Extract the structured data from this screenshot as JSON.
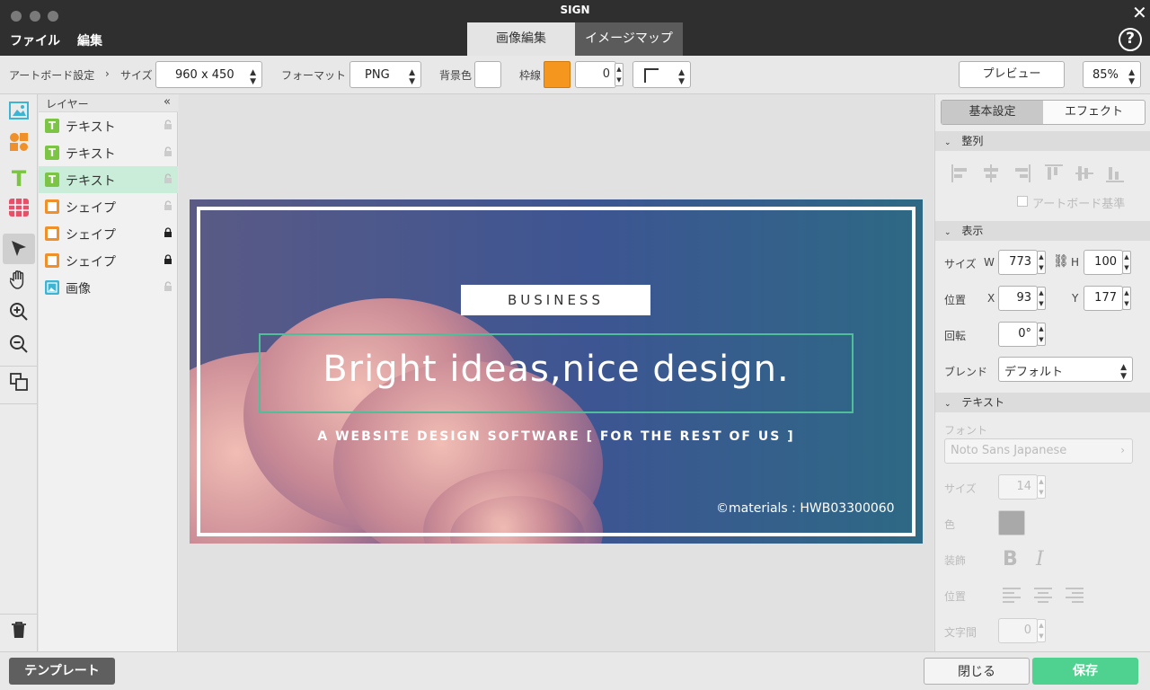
{
  "window": {
    "title": "SIGN",
    "menu": [
      "ファイル",
      "編集"
    ],
    "tabs": [
      "画像編集",
      "イメージマップ"
    ],
    "help": "?",
    "close": "✕"
  },
  "toolbar": {
    "artboard_label": "アートボード設定",
    "chevron": "›",
    "size_label": "サイズ",
    "size_value": "960 x 450",
    "format_label": "フォーマット",
    "format_value": "PNG",
    "bg_label": "背景色",
    "bg_color": "#ffffff",
    "border_label": "枠線",
    "border_color": "#f5961e",
    "border_width": "0",
    "preview": "プレビュー",
    "zoom": "85%"
  },
  "layers": {
    "title": "レイヤー",
    "collapse": "«",
    "items": [
      {
        "name": "テキスト",
        "type": "text",
        "locked": false,
        "selected": false
      },
      {
        "name": "テキスト",
        "type": "text",
        "locked": false,
        "selected": false
      },
      {
        "name": "テキスト",
        "type": "text",
        "locked": false,
        "selected": true
      },
      {
        "name": "シェイプ",
        "type": "shape",
        "locked": false,
        "selected": false
      },
      {
        "name": "シェイプ",
        "type": "shape",
        "locked": true,
        "selected": false
      },
      {
        "name": "シェイプ",
        "type": "shape",
        "locked": true,
        "selected": false
      },
      {
        "name": "画像",
        "type": "image",
        "locked": false,
        "selected": false
      }
    ]
  },
  "tools": [
    "image-tool-icon",
    "shapes-tool-icon",
    "text-tool-icon",
    "table-tool-icon",
    "select-arrow-icon",
    "hand-icon",
    "zoom-in-icon",
    "zoom-out-icon",
    "copy-icon",
    "trash-icon"
  ],
  "artboard": {
    "badge": "BUSINESS",
    "headline": "Bright ideas,nice design.",
    "subline": "A WEBSITE DESIGN SOFTWARE [ FOR THE REST OF US ]",
    "credit": "©materials : HWB03300060"
  },
  "panel": {
    "tabs": [
      "基本設定",
      "エフェクト"
    ],
    "align_title": "整列",
    "artboard_base": "アートボード基準",
    "display_title": "表示",
    "size_label": "サイズ",
    "w_label": "W",
    "w": "773",
    "h_label": "H",
    "h": "100",
    "pos_label": "位置",
    "x_label": "X",
    "x": "93",
    "y_label": "Y",
    "y": "177",
    "rotate_label": "回転",
    "rotate": "0°",
    "blend_label": "ブレンド",
    "blend": "デフォルト",
    "text_title": "テキスト",
    "font_label": "フォント",
    "font": "Noto Sans Japanese",
    "font_size_label": "サイズ",
    "font_size": "14",
    "color_label": "色",
    "color": "#a9a9a9",
    "deco_label": "装飾",
    "bold": "B",
    "italic": "I",
    "align_label": "位置",
    "spacing_label": "文字間",
    "spacing": "0"
  },
  "footer": {
    "template": "テンプレート",
    "close": "閉じる",
    "save": "保存"
  },
  "colors": {
    "accent_green": "#4fd28f",
    "selected_layer": "#c9edd9",
    "orange": "#f5961e"
  }
}
